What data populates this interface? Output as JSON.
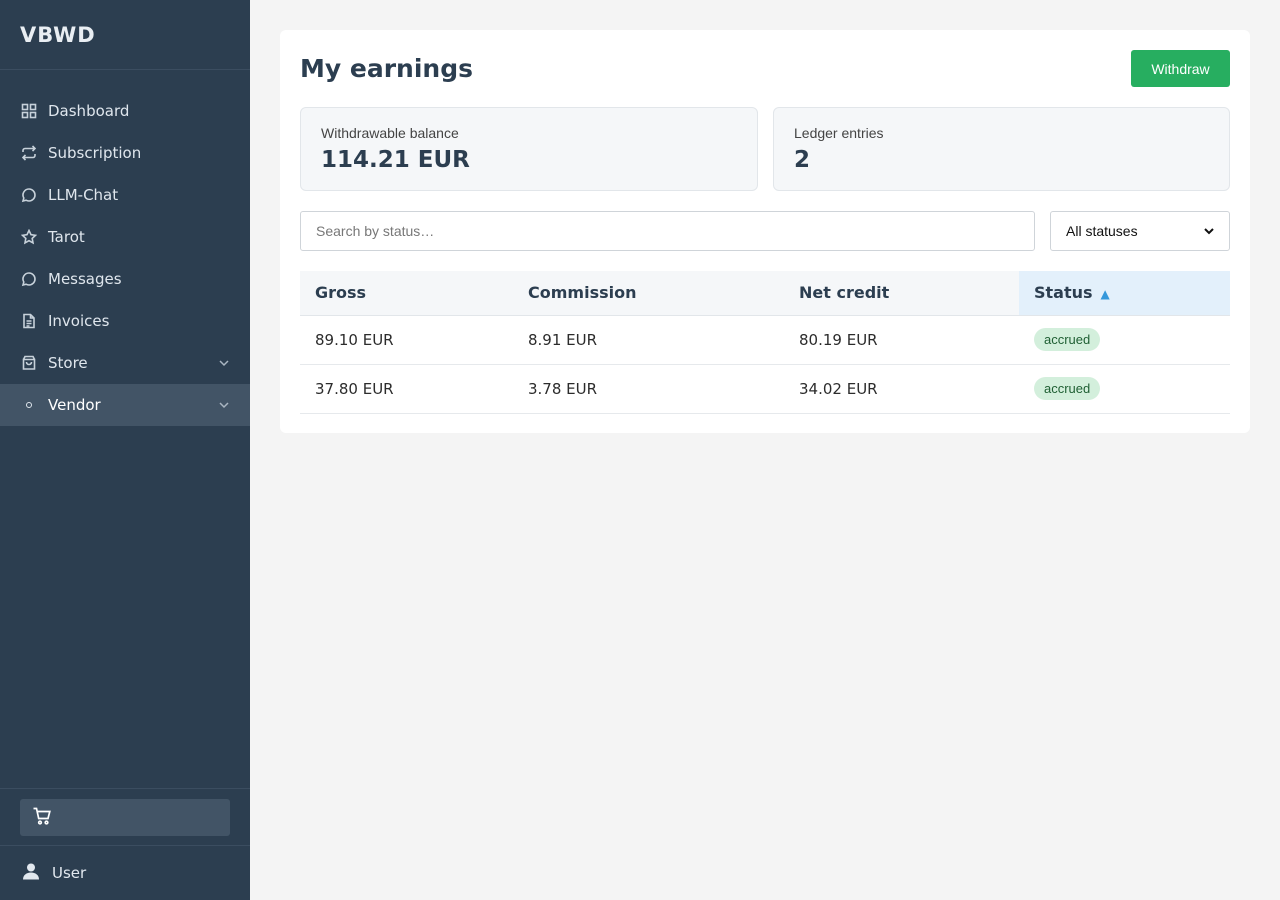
{
  "brand": "VBWD",
  "sidebar": {
    "items": [
      {
        "label": "Dashboard",
        "icon": "grid-icon"
      },
      {
        "label": "Subscription",
        "icon": "repeat-icon"
      },
      {
        "label": "LLM-Chat",
        "icon": "chat-icon"
      },
      {
        "label": "Tarot",
        "icon": "star-icon"
      },
      {
        "label": "Messages",
        "icon": "message-icon"
      },
      {
        "label": "Invoices",
        "icon": "document-icon"
      },
      {
        "label": "Store",
        "icon": "bag-icon",
        "expandable": true
      },
      {
        "label": "Vendor",
        "icon": "dot-icon",
        "expandable": true,
        "active": true
      }
    ],
    "cart_icon": "cart-icon",
    "user_label": "User"
  },
  "main": {
    "title": "My earnings",
    "withdraw_label": "Withdraw",
    "stats": [
      {
        "label": "Withdrawable balance",
        "value": "114.21 EUR"
      },
      {
        "label": "Ledger entries",
        "value": "2"
      }
    ],
    "search_placeholder": "Search by status…",
    "status_filter": "All statuses",
    "table": {
      "columns": [
        "Gross",
        "Commission",
        "Net credit",
        "Status"
      ],
      "sorted_column": "Status",
      "sort_direction": "ascending",
      "rows": [
        {
          "gross": "89.10 EUR",
          "commission": "8.91 EUR",
          "net": "80.19 EUR",
          "status": "accrued"
        },
        {
          "gross": "37.80 EUR",
          "commission": "3.78 EUR",
          "net": "34.02 EUR",
          "status": "accrued"
        }
      ]
    }
  },
  "colors": {
    "sidebar_bg": "#2c3e50",
    "active_item_bg": "#425466",
    "accent_green": "#27ae60",
    "sort_blue": "#3498db",
    "badge_bg": "#d3efdc"
  }
}
